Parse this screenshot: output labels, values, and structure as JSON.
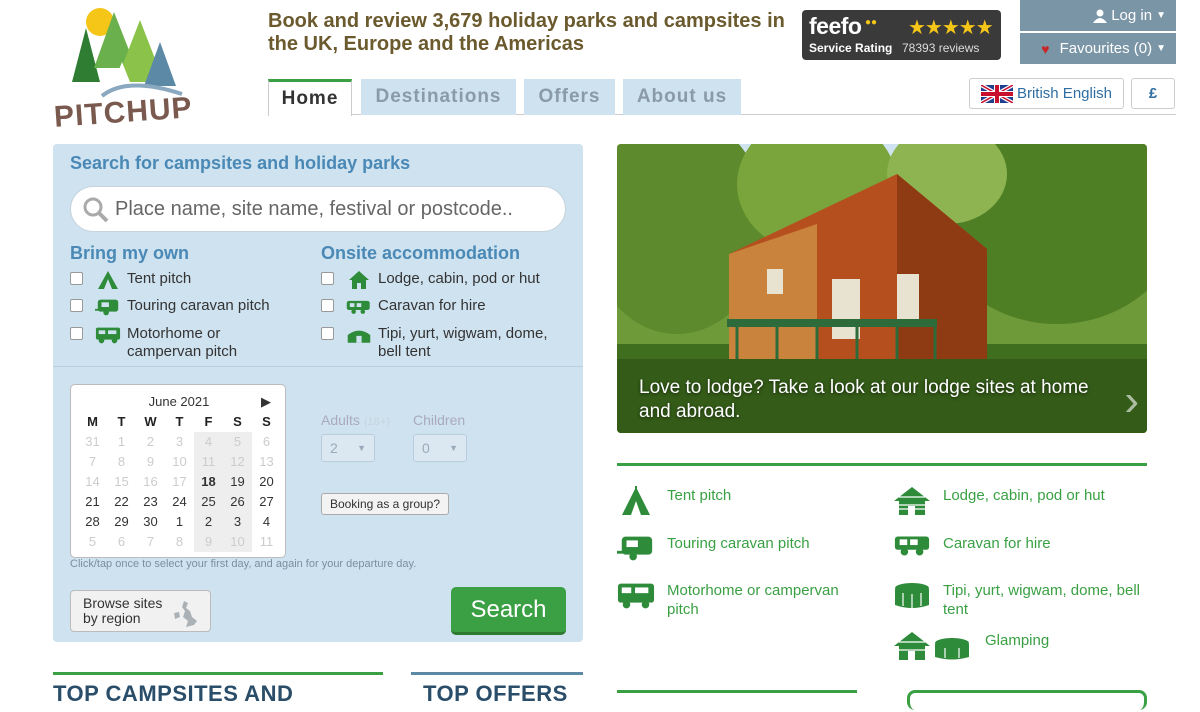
{
  "logo": {
    "text": "PITCHUP"
  },
  "header": {
    "headline": "Book and review 3,679 holiday parks and campsites in the UK, Europe and the Americas"
  },
  "feefo": {
    "brand": "feefo",
    "stars": "★★★★★",
    "rating_label": "Service Rating",
    "reviews": "78393 reviews"
  },
  "account": {
    "login": "Log in",
    "favourites": "Favourites (0)"
  },
  "tabs": [
    {
      "label": "Home"
    },
    {
      "label": "Destinations"
    },
    {
      "label": "Offers"
    },
    {
      "label": "About us"
    }
  ],
  "locale": {
    "language": "British English",
    "currency": "£"
  },
  "search": {
    "title": "Search for campsites and holiday parks",
    "placeholder": "Place name, site name, festival or postcode..",
    "bring_heading": "Bring my own",
    "bring_options": [
      "Tent pitch",
      "Touring caravan pitch",
      "Motorhome or campervan pitch"
    ],
    "onsite_heading": "Onsite accommodation",
    "onsite_options": [
      "Lodge, cabin, pod or hut",
      "Caravan for hire",
      "Tipi, yurt, wigwam, dome, bell tent"
    ],
    "calendar": {
      "month": "June 2021",
      "next": "▶",
      "days": [
        "M",
        "T",
        "W",
        "T",
        "F",
        "S",
        "S"
      ],
      "weeks": [
        [
          "31",
          "1",
          "2",
          "3",
          "4",
          "5",
          "6"
        ],
        [
          "7",
          "8",
          "9",
          "10",
          "11",
          "12",
          "13"
        ],
        [
          "14",
          "15",
          "16",
          "17",
          "18",
          "19",
          "20"
        ],
        [
          "21",
          "22",
          "23",
          "24",
          "25",
          "26",
          "27"
        ],
        [
          "28",
          "29",
          "30",
          "1",
          "2",
          "3",
          "4"
        ],
        [
          "5",
          "6",
          "7",
          "8",
          "9",
          "10",
          "11"
        ]
      ]
    },
    "calendar_hint": "Click/tap once to select your first day, and again for your departure day.",
    "adults_label": "Adults",
    "adults_note": "(18+)",
    "adults_value": "2",
    "children_label": "Children",
    "children_value": "0",
    "group_button": "Booking as a group?",
    "browse_button": "Browse sites by region",
    "search_button": "Search"
  },
  "hero": {
    "caption": "Love to lodge? Take a look at our lodge sites at home and abroad.",
    "arrow": "›"
  },
  "accommodation_links": [
    {
      "label": "Tent pitch",
      "icon": "tent-icon"
    },
    {
      "label": "Lodge, cabin, pod or hut",
      "icon": "lodge-icon"
    },
    {
      "label": "Touring caravan pitch",
      "icon": "caravan-icon"
    },
    {
      "label": "Caravan for hire",
      "icon": "caravan-hire-icon"
    },
    {
      "label": "Motorhome or campervan pitch",
      "icon": "motorhome-icon"
    },
    {
      "label": "Tipi, yurt, wigwam, dome, bell tent",
      "icon": "yurt-icon"
    },
    {
      "label": "Glamping",
      "icon": "glamping-icon"
    }
  ],
  "sections": {
    "top_campsites": "TOP CAMPSITES AND",
    "top_offers": "TOP OFFERS"
  },
  "colors": {
    "green": "#3aa043",
    "blue": "#4a89b5",
    "panel": "#cfe2f0",
    "headline": "#6b5a2e"
  }
}
